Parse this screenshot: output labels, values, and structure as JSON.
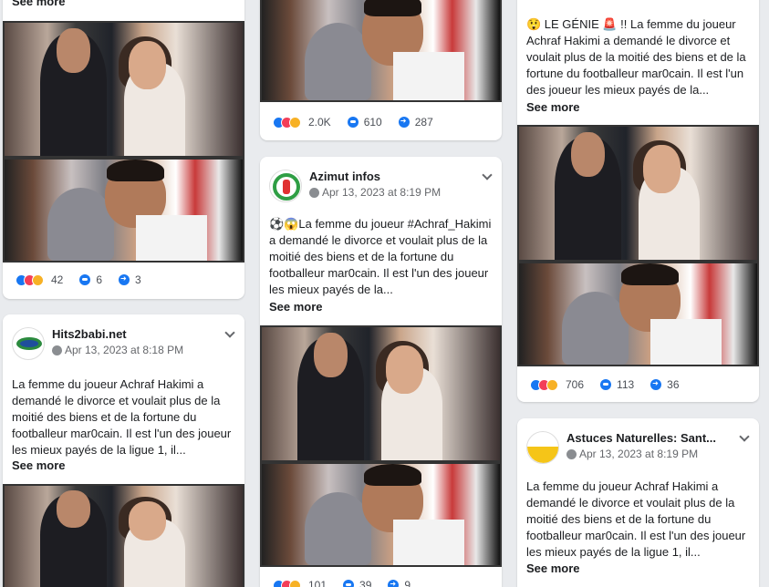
{
  "see_more": "See more",
  "col1": {
    "stats": {
      "reactions": "42",
      "comments": "6",
      "shares": "3"
    },
    "post2": {
      "name": "Hits2babi.net",
      "date": "Apr 13, 2023 at 8:18 PM",
      "text": "La femme du joueur Achraf Hakimi a demandé le divorce et voulait plus de la moitié des biens et de la fortune du footballeur mar0cain. Il est l'un des joueur les mieux payés de la ligue 1, il..."
    }
  },
  "col2": {
    "stats": {
      "reactions": "2.0K",
      "comments": "610",
      "shares": "287"
    },
    "post2": {
      "name": "Azimut infos",
      "date": "Apr 13, 2023 at 8:19 PM",
      "text": "⚽😱La femme du joueur #Achraf_Hakimi a demandé le divorce et voulait plus de la moitié des biens et de la fortune du footballeur mar0cain. Il est l'un des joueur les mieux payés de la...",
      "stats": {
        "reactions": "101",
        "comments": "39",
        "shares": "9"
      }
    }
  },
  "col3": {
    "post1_text": "😲 LE GÉNIE 🚨 !! La femme du joueur Achraf Hakimi a demandé le divorce et voulait plus de la moitié des biens et de la fortune du footballeur mar0cain. Il est l'un des joueur les mieux payés de la...",
    "stats": {
      "reactions": "706",
      "comments": "113",
      "shares": "36"
    },
    "post2": {
      "name": "Astuces Naturelles: Sant...",
      "date": "Apr 13, 2023 at 8:19 PM",
      "text": "La femme du joueur Achraf Hakimi a demandé le divorce et voulait plus de la moitié des biens et de la fortune du footballeur mar0cain. Il est l'un des joueur les mieux payés de la ligue 1, il..."
    }
  }
}
